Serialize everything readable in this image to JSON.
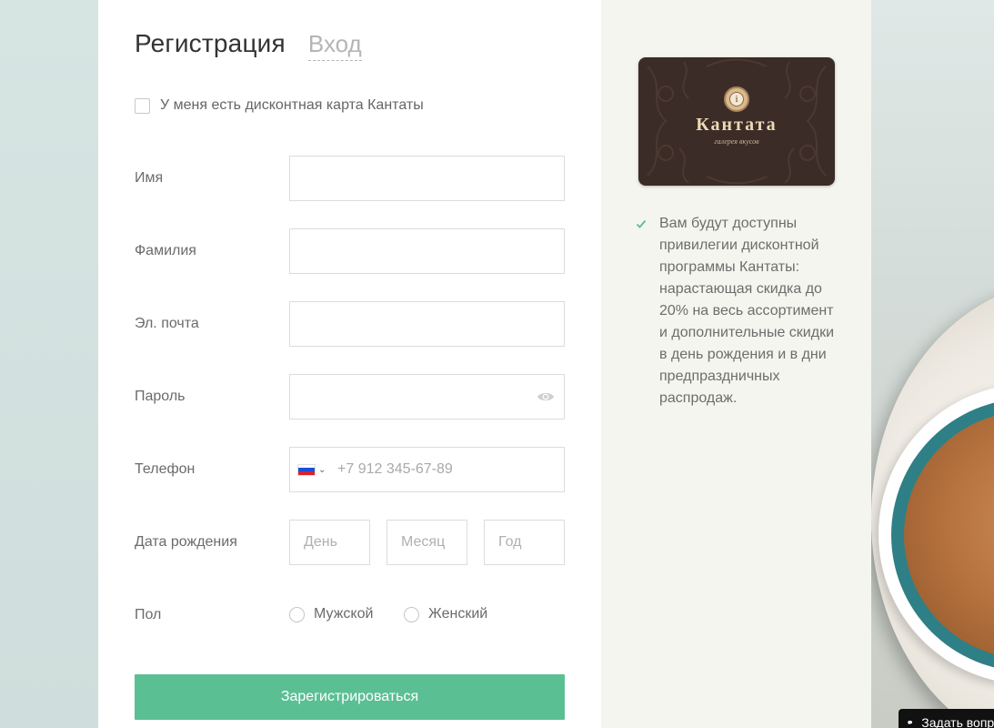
{
  "tabs": {
    "register": "Регистрация",
    "login": "Вход"
  },
  "discount_checkbox": {
    "label": "У меня есть дисконтная карта Кантаты",
    "checked": false
  },
  "fields": {
    "first_name": {
      "label": "Имя",
      "value": ""
    },
    "last_name": {
      "label": "Фамилия",
      "value": ""
    },
    "email": {
      "label": "Эл. почта",
      "value": ""
    },
    "password": {
      "label": "Пароль",
      "value": "",
      "icon": "eye-icon"
    },
    "phone": {
      "label": "Телефон",
      "placeholder": "+7 912 345-67-89",
      "country": "RU"
    },
    "birthdate": {
      "label": "Дата рождения",
      "day_placeholder": "День",
      "month_placeholder": "Месяц",
      "year_placeholder": "Год"
    },
    "gender": {
      "label": "Пол",
      "options": [
        "Мужской",
        "Женский"
      ],
      "selected": null
    }
  },
  "submit_label": "Зарегистрироваться",
  "card": {
    "brand": "Кантата",
    "tagline": "галерея вкусов"
  },
  "benefit_text": "Вам будут доступны привилегии дисконтной программы Кантаты: нарастающая скидка до 20% на весь ассортимент и дополнительные скидки в день рождения и в дни предпраздничных распродаж.",
  "chat_widget": {
    "label": "Задать вопрос"
  },
  "colors": {
    "accent": "#5bbf94",
    "check": "#5bbf94",
    "card_bg": "#3b2c27"
  }
}
